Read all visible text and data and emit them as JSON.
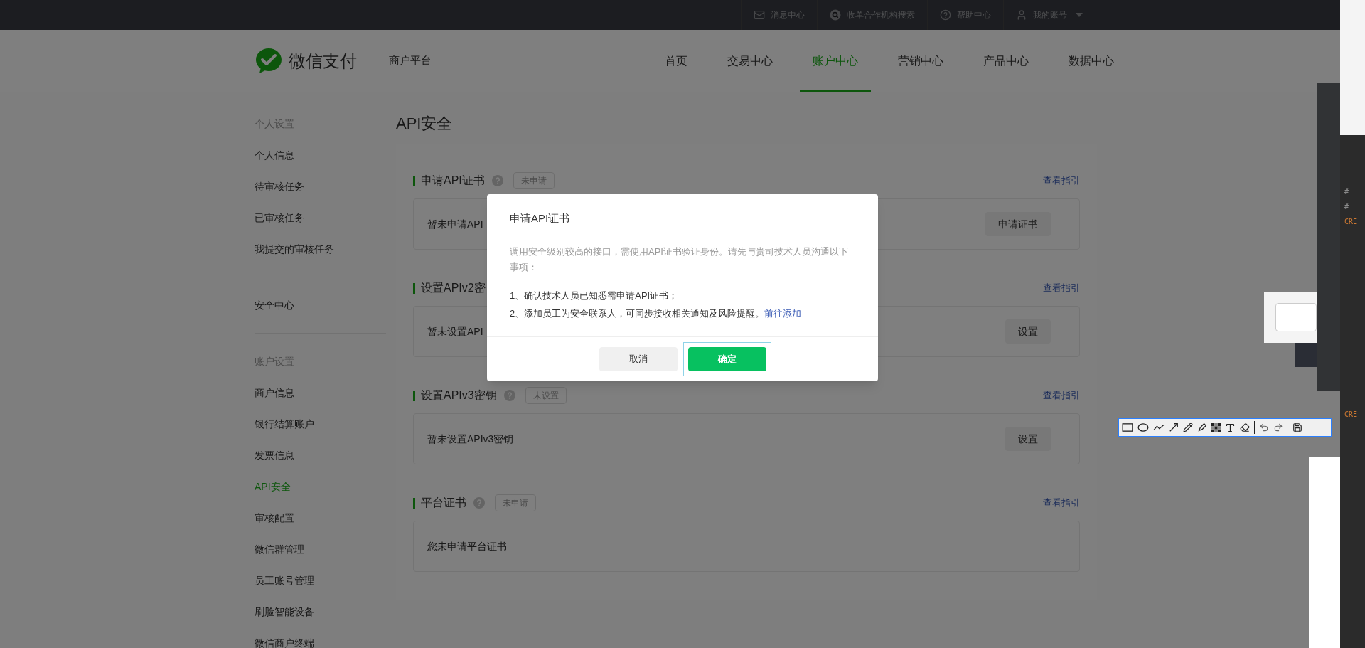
{
  "top_bar": {
    "items": [
      {
        "kind": "mail",
        "label": "消息中心"
      },
      {
        "kind": "search",
        "label": "收单合作机构搜索"
      },
      {
        "kind": "help",
        "label": "帮助中心"
      },
      {
        "kind": "user",
        "label": "我的账号",
        "dropdown": true
      }
    ]
  },
  "header": {
    "logo_text": "微信支付",
    "platform": "商户平台",
    "nav": [
      {
        "label": "首页",
        "selected": false
      },
      {
        "label": "交易中心",
        "selected": false
      },
      {
        "label": "账户中心",
        "selected": true
      },
      {
        "label": "营销中心",
        "selected": false
      },
      {
        "label": "产品中心",
        "selected": false
      },
      {
        "label": "数据中心",
        "selected": false
      }
    ]
  },
  "sidebar": {
    "groups": [
      {
        "heading": "个人设置",
        "items": [
          {
            "label": "个人信息",
            "selected": false
          },
          {
            "label": "待审核任务",
            "selected": false
          },
          {
            "label": "已审核任务",
            "selected": false
          },
          {
            "label": "我提交的审核任务",
            "selected": false
          }
        ]
      },
      {
        "items": [
          {
            "label": "安全中心",
            "selected": false
          }
        ]
      },
      {
        "heading": "账户设置",
        "items": [
          {
            "label": "商户信息",
            "selected": false
          },
          {
            "label": "银行结算账户",
            "selected": false
          },
          {
            "label": "发票信息",
            "selected": false
          },
          {
            "label": "API安全",
            "selected": true
          },
          {
            "label": "审核配置",
            "selected": false
          },
          {
            "label": "微信群管理",
            "selected": false
          },
          {
            "label": "员工账号管理",
            "selected": false
          },
          {
            "label": "刷脸智能设备",
            "selected": false
          },
          {
            "label": "微信商户终端",
            "selected": false
          }
        ]
      }
    ]
  },
  "page_title": "API安全",
  "sections": [
    {
      "title": "申请API证书",
      "help": true,
      "status": "未申请",
      "guide_link": "查看指引",
      "body": "暂未申请API",
      "action": "申请证书"
    },
    {
      "title": "设置APIv2密",
      "guide_link": "查看指引",
      "body": "暂未设置API",
      "action": "设置"
    },
    {
      "title": "设置APIv3密钥",
      "help": true,
      "status": "未设置",
      "guide_link": "查看指引",
      "body": "暂未设置APIv3密钥",
      "action": "设置"
    },
    {
      "title": "平台证书",
      "help": true,
      "status": "未申请",
      "guide_link": "查看指引",
      "body": "您未申请平台证书"
    }
  ],
  "modal": {
    "title": "申请API证书",
    "intro": "调用安全级别较高的接口，需使用API证书验证身份。请先与贵司技术人员沟通以下事项：",
    "list": [
      "1、确认技术人员已知悉需申请API证书；",
      "2、添加员工为安全联系人，可同步接收相关通知及风险提醒。"
    ],
    "link": "前往添加",
    "buttons": [
      {
        "label": "取消",
        "kind": "secondary",
        "focused": false
      },
      {
        "label": "确定",
        "kind": "primary",
        "focused": true
      }
    ]
  },
  "code_fragments": [
    "#",
    "#",
    "CRE",
    "CRE"
  ]
}
